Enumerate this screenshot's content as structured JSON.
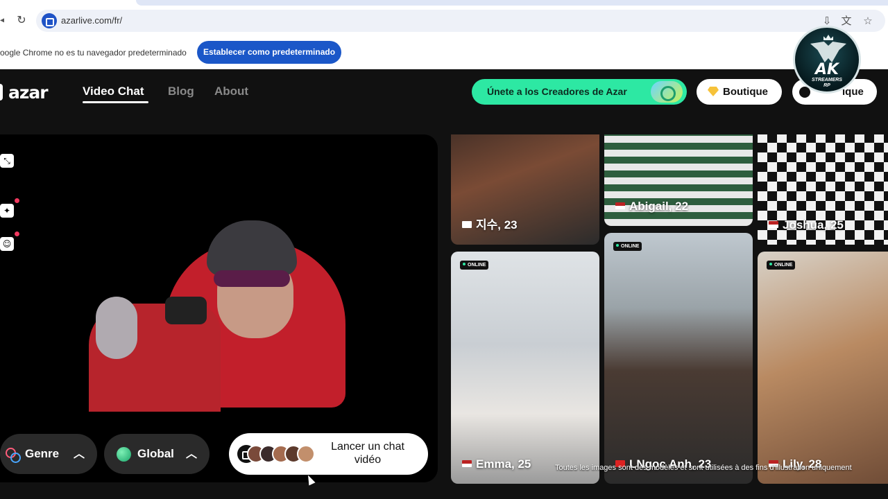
{
  "browser": {
    "url": "azarlive.com/fr/",
    "infobar_text": "oogle Chrome no es tu navegador predeterminado",
    "default_button": "Establecer como predeterminado"
  },
  "site": {
    "logo": "azar",
    "nav": [
      "Video Chat",
      "Blog",
      "About"
    ],
    "creators_button": "Únete a los Creadores de Azar",
    "boutique_button": "Boutique",
    "second_pill_label": "ique"
  },
  "badge": {
    "title": "AK",
    "subtitle": "STREAMERS",
    "tag": "RP"
  },
  "video": {
    "genre_label": "Genre",
    "global_label": "Global",
    "launch_label": "Lancer un chat vidéo"
  },
  "profiles": [
    {
      "name": "지수, 23",
      "online": false
    },
    {
      "name": "Abigail, 22",
      "online": false
    },
    {
      "name": "Joshua, 25",
      "online": false
    },
    {
      "name": "Emma, 25",
      "online": true
    },
    {
      "name": "LNgọc Anh, 23",
      "online": true
    },
    {
      "name": "Lily, 28",
      "online": true
    }
  ],
  "online_badge": "ONLINE",
  "disclaimer": "Toutes les images sont des modèles et sont utilisées à des fins d'illustration uniquement",
  "icons": [
    "reload-icon",
    "site-icon",
    "install-icon",
    "translate-icon",
    "star-icon",
    "diamond-icon",
    "clock-icon",
    "resize-icon",
    "magic-wand-icon",
    "smiley-icon",
    "genre-icon",
    "globe-icon",
    "chevron-up-icon",
    "video-camera-icon"
  ],
  "colors": {
    "accent_green": "#2de8a3",
    "chrome_blue": "#1b57c8",
    "notify_red": "#f0385e"
  }
}
